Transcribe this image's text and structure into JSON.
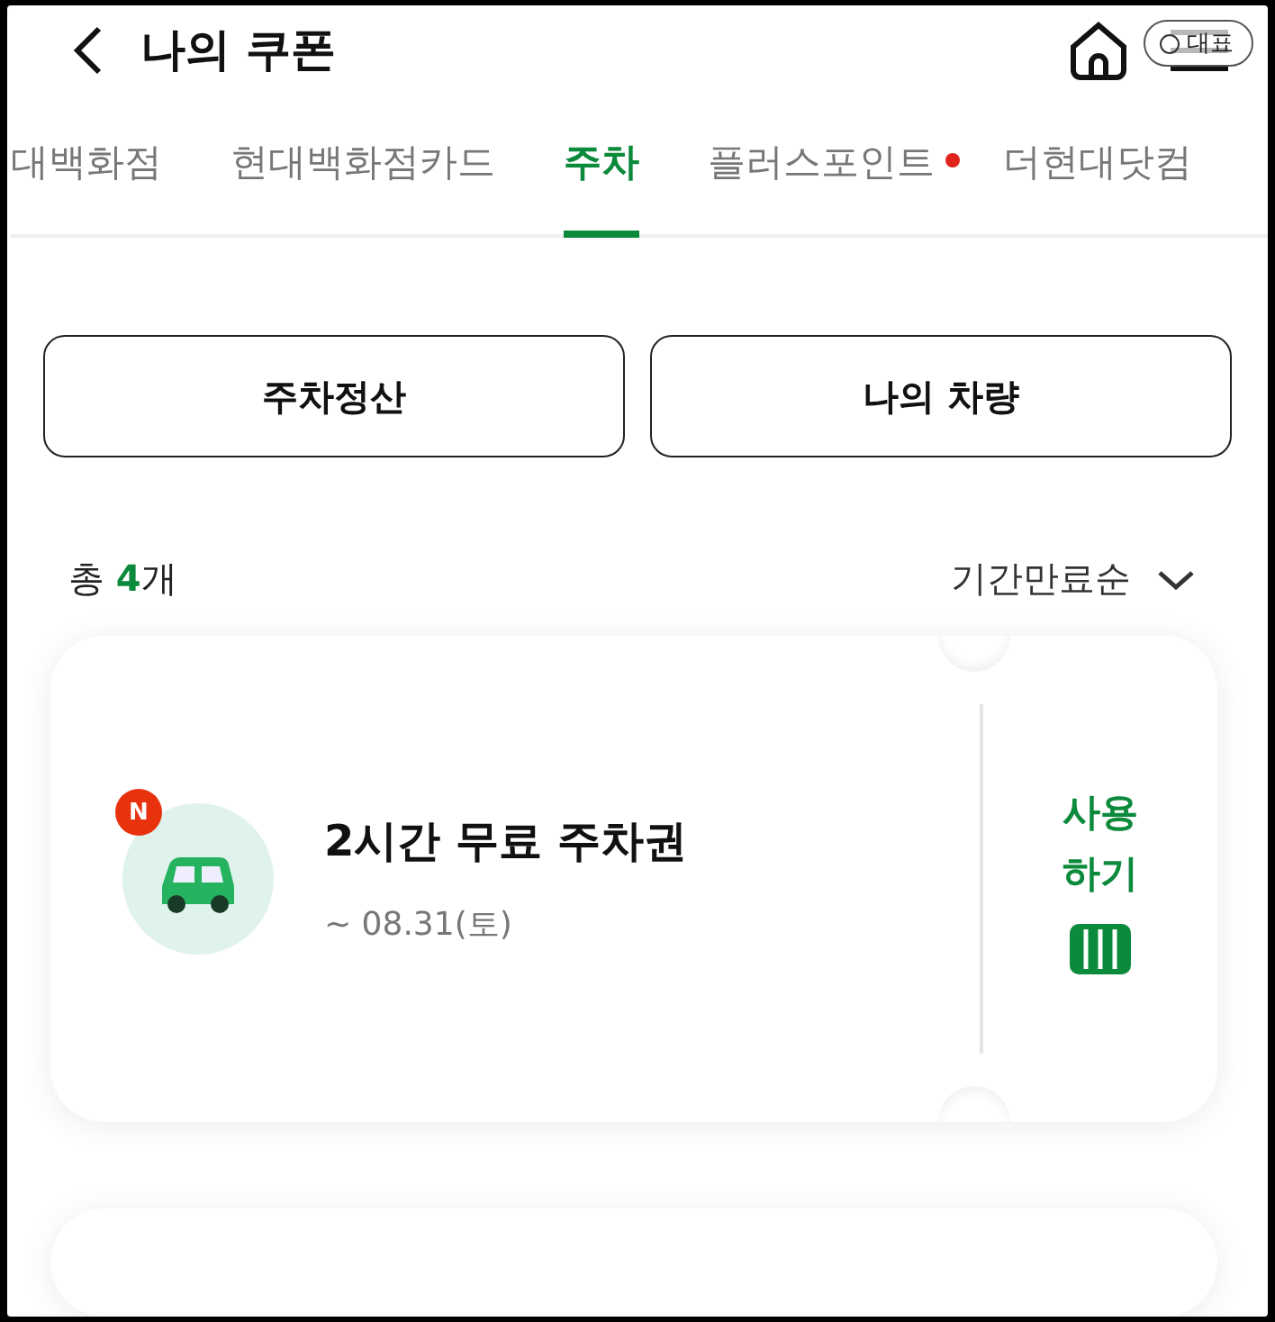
{
  "header": {
    "title": "나의 쿠폰",
    "chip": "대표"
  },
  "tabs": [
    {
      "label": "대백화점",
      "selected": false,
      "new": false
    },
    {
      "label": "현대백화점카드",
      "selected": false,
      "new": false
    },
    {
      "label": "주차",
      "selected": true,
      "new": false
    },
    {
      "label": "플러스포인트",
      "selected": false,
      "new": true
    },
    {
      "label": "더현대닷컴",
      "selected": false,
      "new": false
    }
  ],
  "actions": [
    "주차정산",
    "나의 차량"
  ],
  "summary": {
    "prefix": "총 ",
    "count": "4",
    "suffix": "개",
    "sort": "기간만료순"
  },
  "coupons": [
    {
      "badge": "N",
      "title": "2시간 무료 주차권",
      "period": "~ 08.31(토)",
      "use": "사용\n하기"
    }
  ]
}
